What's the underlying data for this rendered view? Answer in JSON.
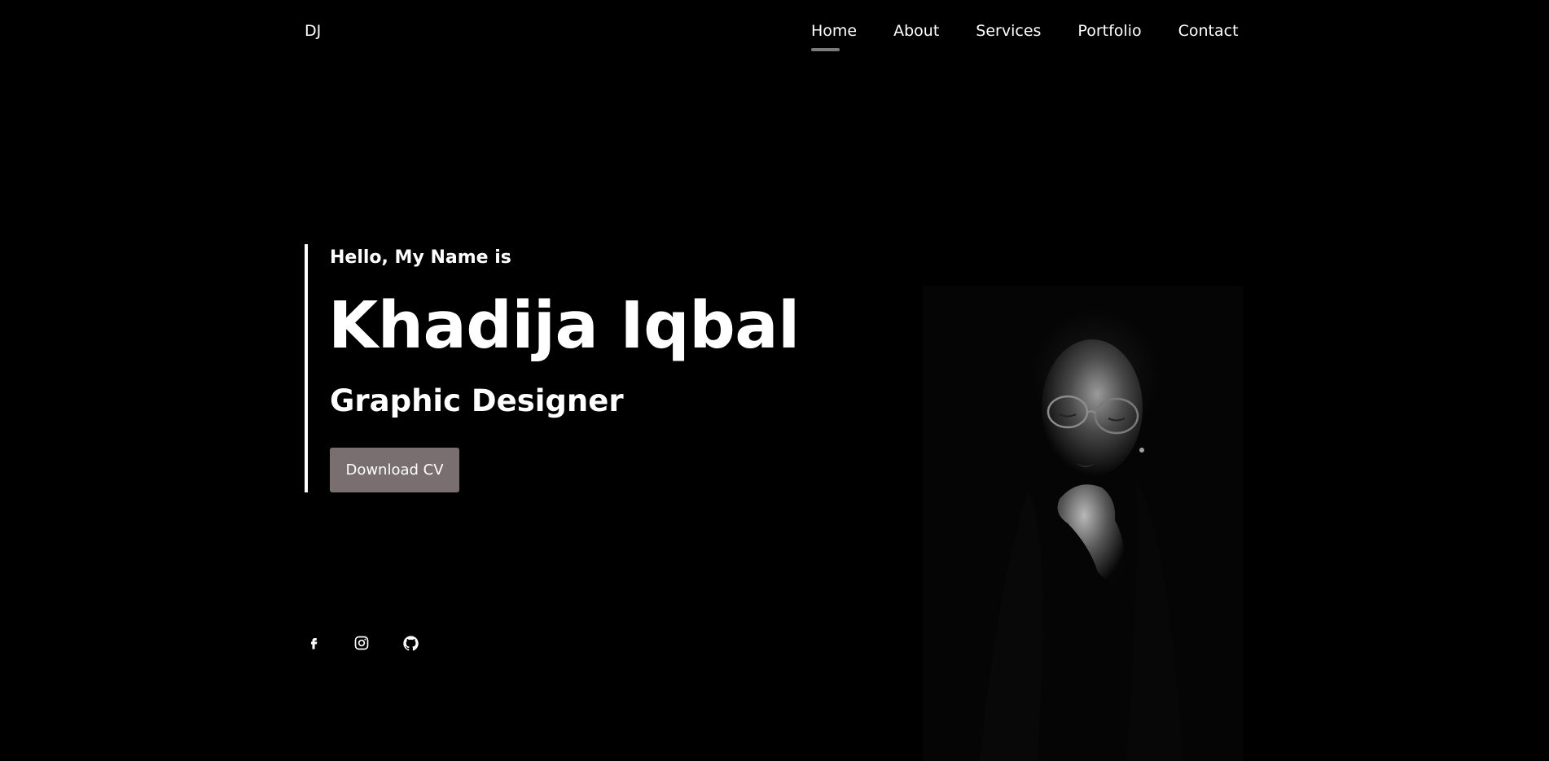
{
  "header": {
    "logo": "DJ",
    "nav": [
      {
        "label": "Home",
        "active": true
      },
      {
        "label": "About",
        "active": false
      },
      {
        "label": "Services",
        "active": false
      },
      {
        "label": "Portfolio",
        "active": false
      },
      {
        "label": "Contact",
        "active": false
      }
    ]
  },
  "hero": {
    "greeting": "Hello, My Name is",
    "name": "Khadija Iqbal",
    "role": "Graphic Designer",
    "cta_label": "Download CV"
  },
  "social": [
    {
      "icon": "facebook-icon"
    },
    {
      "icon": "instagram-icon"
    },
    {
      "icon": "github-icon"
    }
  ],
  "colors": {
    "background": "#000000",
    "text": "#ffffff",
    "button": "#7a6f70",
    "active_underline": "#7b7b7b"
  }
}
